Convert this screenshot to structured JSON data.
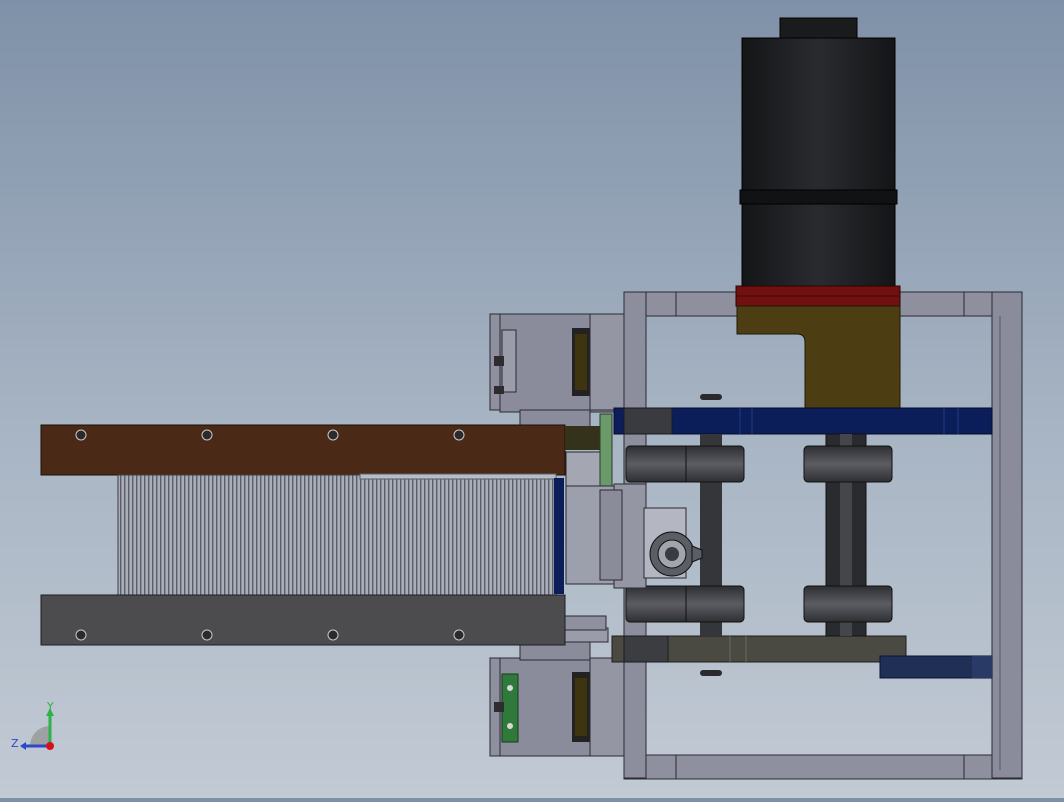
{
  "view": {
    "type": "cad-assembly-top-view",
    "background_top": "#7f91a8",
    "background_bottom": "#c2cad4"
  },
  "triad": {
    "x_label": "",
    "y_label": "Y",
    "z_label": "Z",
    "y_color": "#2bb34a",
    "z_color": "#2c49c9",
    "origin_color": "#d4121a"
  },
  "colors": {
    "frame": "#8c8e9e",
    "motor": "#1d1e21",
    "motor_flange": "#7a1010",
    "motor_mount": "#4a3c12",
    "blue_bar": "#0c1e5a",
    "brown_plate": "#4a2a16",
    "dark_plate": "#4a4a4c",
    "fins": "#9aa0aa",
    "green_pcb": "#2f7a3a"
  }
}
